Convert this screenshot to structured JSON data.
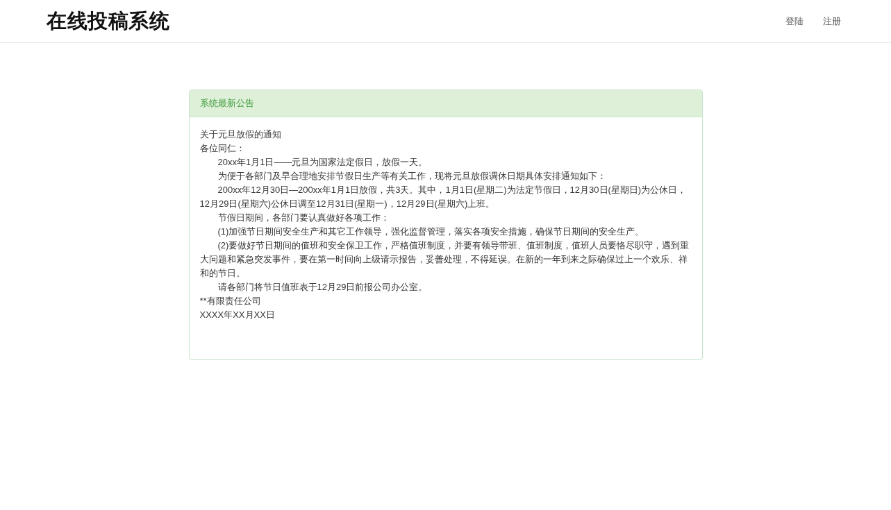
{
  "header": {
    "title": "在线投稿系统",
    "nav": [
      "登陆",
      "注册"
    ]
  },
  "panel": {
    "heading": "系统最新公告",
    "paragraphs": [
      {
        "kind": "plain",
        "text": "关于元旦放假的通知"
      },
      {
        "kind": "plain",
        "text": "各位同仁："
      },
      {
        "kind": "indent",
        "text": "20xx年1月1日——元旦为国家法定假日，放假一天。"
      },
      {
        "kind": "indent",
        "text": "为便于各部门及早合理地安排节假日生产等有关工作，现将元旦放假调休日期具体安排通知如下："
      },
      {
        "kind": "indent",
        "text": "200xx年12月30日—200xx年1月1日放假，共3天。其中，1月1日(星期二)为法定节假日，12月30日(星期日)为公休日，12月29日(星期六)公休日调至12月31日(星期一)，12月29日(星期六)上班。"
      },
      {
        "kind": "indent",
        "text": "节假日期间，各部门要认真做好各项工作："
      },
      {
        "kind": "indent",
        "text": "(1)加强节日期间安全生产和其它工作领导，强化监督管理，落实各项安全措施，确保节日期间的安全生产。"
      },
      {
        "kind": "indent",
        "text": "(2)要做好节日期间的值班和安全保卫工作，严格值班制度，并要有领导带班、值班制度，值班人员要恪尽职守，遇到重大问题和紧急突发事件，要在第一时间向上级请示报告，妥善处理，不得延误。在新的一年到来之际确保过上一个欢乐、祥和的节日。"
      },
      {
        "kind": "indent",
        "text": "请各部门将节日值班表于12月29日前报公司办公室。"
      },
      {
        "kind": "plain",
        "text": "**有限责任公司"
      },
      {
        "kind": "plain",
        "text": "XXXX年XX月XX日"
      }
    ]
  }
}
